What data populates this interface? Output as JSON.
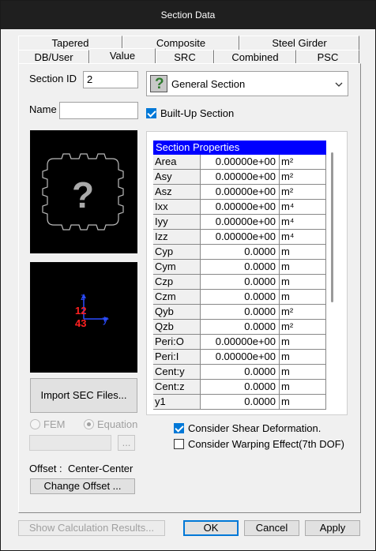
{
  "window": {
    "title": "Section Data"
  },
  "tabs": {
    "row1": [
      "Tapered",
      "Composite",
      "Steel Girder"
    ],
    "row2": [
      "DB/User",
      "Value",
      "SRC",
      "Combined",
      "PSC"
    ]
  },
  "fields": {
    "section_id_label": "Section ID",
    "section_id_value": "2",
    "name_label": "Name",
    "name_value": "",
    "section_type": "General Section",
    "built_up_label": "Built-Up Section",
    "built_up_checked": true
  },
  "import_button": "Import SEC Files...",
  "fem_label": "FEM",
  "equation_label": "Equation",
  "browse_label": "...",
  "offset_label": "Offset :",
  "offset_value": "Center-Center",
  "change_offset_button": "Change Offset ...",
  "table": {
    "header": "Section Properties",
    "rows": [
      {
        "name": "Area",
        "value": "0.00000e+00",
        "unit": "m²"
      },
      {
        "name": "Asy",
        "value": "0.00000e+00",
        "unit": "m²"
      },
      {
        "name": "Asz",
        "value": "0.00000e+00",
        "unit": "m²"
      },
      {
        "name": "Ixx",
        "value": "0.00000e+00",
        "unit": "m⁴"
      },
      {
        "name": "Iyy",
        "value": "0.00000e+00",
        "unit": "m⁴"
      },
      {
        "name": "Izz",
        "value": "0.00000e+00",
        "unit": "m⁴"
      },
      {
        "name": "Cyp",
        "value": "0.0000",
        "unit": "m"
      },
      {
        "name": "Cym",
        "value": "0.0000",
        "unit": "m"
      },
      {
        "name": "Czp",
        "value": "0.0000",
        "unit": "m"
      },
      {
        "name": "Czm",
        "value": "0.0000",
        "unit": "m"
      },
      {
        "name": "Qyb",
        "value": "0.0000",
        "unit": "m²"
      },
      {
        "name": "Qzb",
        "value": "0.0000",
        "unit": "m²"
      },
      {
        "name": "Peri:O",
        "value": "0.00000e+00",
        "unit": "m"
      },
      {
        "name": "Peri:I",
        "value": "0.00000e+00",
        "unit": "m"
      },
      {
        "name": "Cent:y",
        "value": "0.0000",
        "unit": "m"
      },
      {
        "name": "Cent:z",
        "value": "0.0000",
        "unit": "m"
      },
      {
        "name": "y1",
        "value": "0.0000",
        "unit": "m"
      }
    ]
  },
  "consider_shear_label": "Consider Shear Deformation.",
  "consider_shear_checked": true,
  "consider_warping_label": "Consider Warping Effect(7th DOF)",
  "consider_warping_checked": false,
  "axis_labels": {
    "z": "z",
    "y": "y",
    "n12": "12",
    "n43": "43"
  },
  "buttons": {
    "show_calc": "Show Calculation Results...",
    "ok": "OK",
    "cancel": "Cancel",
    "apply": "Apply"
  }
}
